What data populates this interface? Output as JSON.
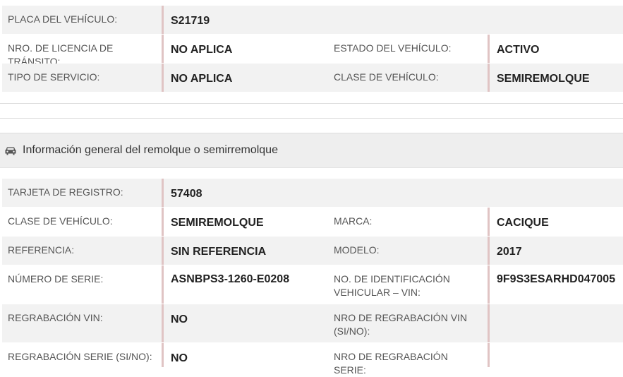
{
  "vehicle": {
    "rows": [
      {
        "label1": "PLACA DEL VEHÍCULO:",
        "value1": "S21719",
        "label2": "",
        "value2": ""
      },
      {
        "label1": "NRO. DE LICENCIA DE TRÁNSITO:",
        "value1": "NO APLICA",
        "label2": "ESTADO DEL VEHÍCULO:",
        "value2": "ACTIVO"
      },
      {
        "label1": "TIPO DE SERVICIO:",
        "value1": "NO APLICA",
        "label2": "CLASE DE VEHÍCULO:",
        "value2": "SEMIREMOLQUE"
      }
    ]
  },
  "trailer": {
    "icon": "car-icon",
    "title": "Información general del remolque o semirremolque",
    "rows": [
      {
        "label1": "TARJETA DE REGISTRO:",
        "value1": "57408",
        "label2": "",
        "value2": ""
      },
      {
        "label1": "CLASE DE VEHÍCULO:",
        "value1": "SEMIREMOLQUE",
        "label2": "MARCA:",
        "value2": "CACIQUE"
      },
      {
        "label1": "REFERENCIA:",
        "value1": "SIN REFERENCIA",
        "label2": "MODELO:",
        "value2": "2017"
      },
      {
        "label1": "NÚMERO DE SERIE:",
        "value1": "ASNBPS3-1260-E0208",
        "label2": "NO. DE IDENTIFICACIÓN VEHICULAR – VIN:",
        "value2": "9F9S3ESARHD047005"
      },
      {
        "label1": "REGRABACIÓN VIN:",
        "value1": "NO",
        "label2": "NRO DE REGRABACIÓN VIN (SI/NO):",
        "value2": ""
      },
      {
        "label1": "REGRABACIÓN SERIE (SI/NO):",
        "value1": "NO",
        "label2": "NRO DE REGRABACIÓN SERIE:",
        "value2": ""
      }
    ]
  }
}
